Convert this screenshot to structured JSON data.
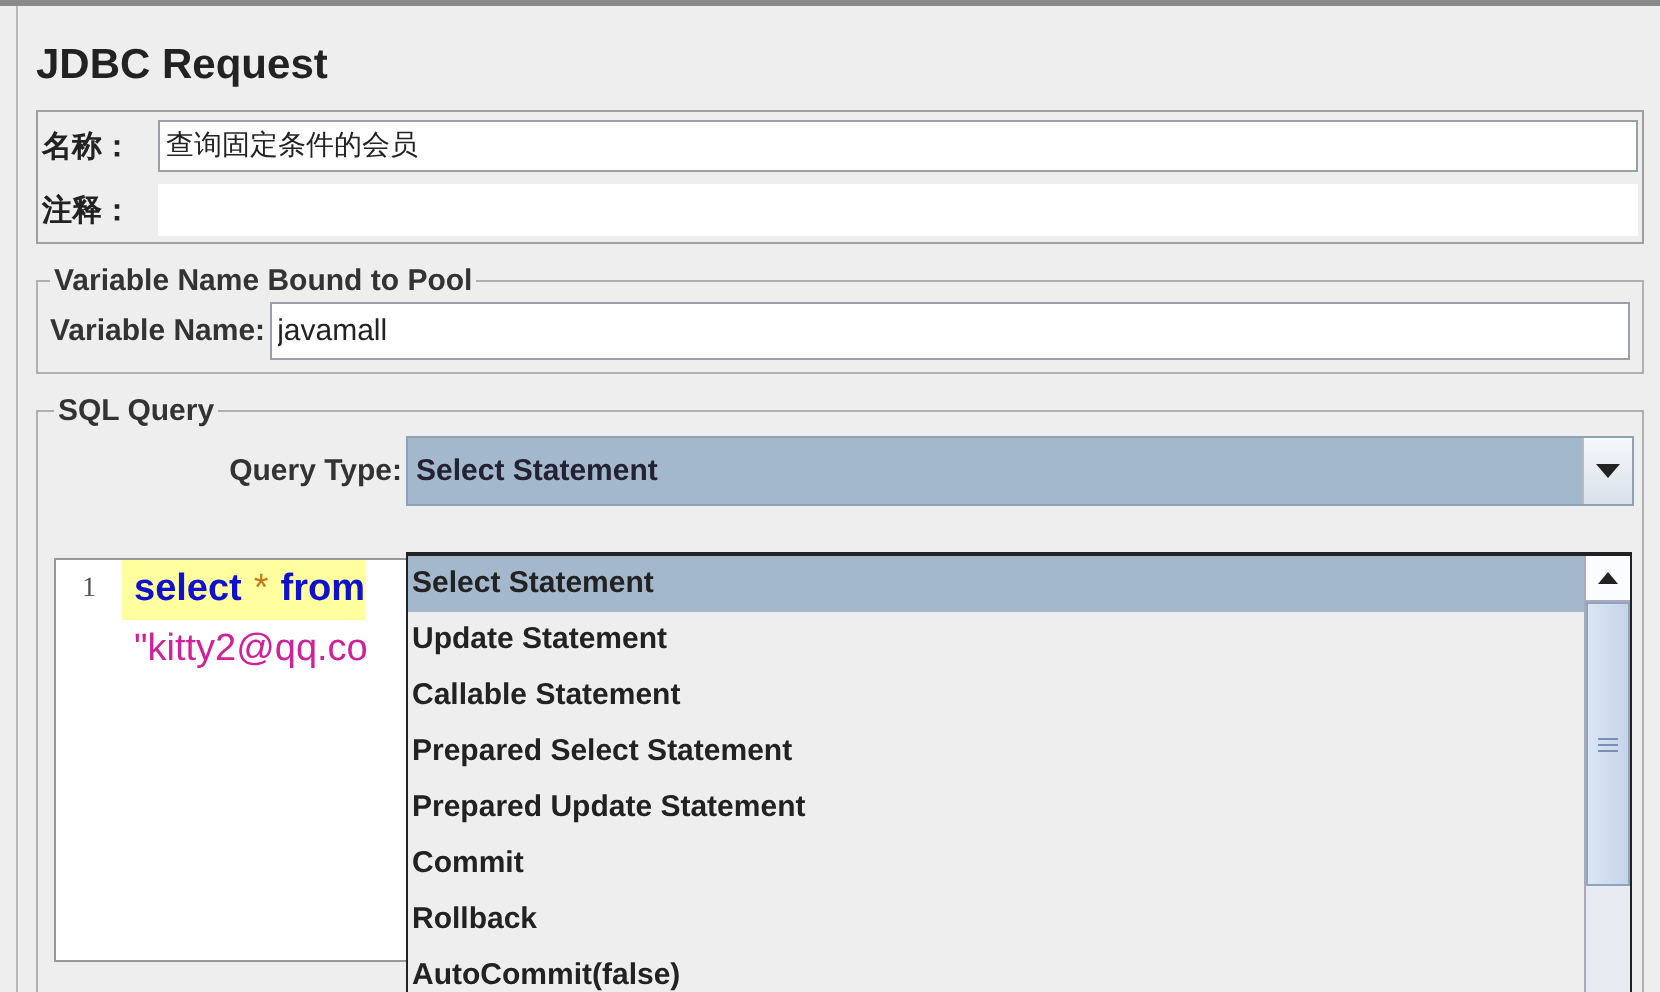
{
  "title": "JDBC Request",
  "name_field": {
    "label": "名称：",
    "value": "查询固定条件的会员"
  },
  "comment_field": {
    "label": "注释："
  },
  "pool_group": {
    "legend": "Variable Name Bound to Pool",
    "label": "Variable Name:",
    "value": "javamall"
  },
  "sql_group": {
    "legend": "SQL Query",
    "query_type_label": "Query Type:",
    "query_type_value": "Select Statement",
    "editor": {
      "lines": [
        {
          "number": "1",
          "current": true,
          "tokens": [
            {
              "kind": "keyword",
              "text": "select"
            },
            {
              "kind": "operator",
              "text": "*"
            },
            {
              "kind": "keyword",
              "text": "from"
            }
          ]
        },
        {
          "current": false,
          "tokens": [
            {
              "kind": "string",
              "text": "\"kitty2@qq.co"
            }
          ]
        }
      ]
    },
    "options": [
      {
        "label": "Select Statement",
        "selected": true
      },
      {
        "label": "Update Statement",
        "selected": false
      },
      {
        "label": "Callable Statement",
        "selected": false
      },
      {
        "label": "Prepared Select Statement",
        "selected": false
      },
      {
        "label": "Prepared Update Statement",
        "selected": false
      },
      {
        "label": "Commit",
        "selected": false
      },
      {
        "label": "Rollback",
        "selected": false
      },
      {
        "label": "AutoCommit(false)",
        "selected": false
      }
    ]
  }
}
